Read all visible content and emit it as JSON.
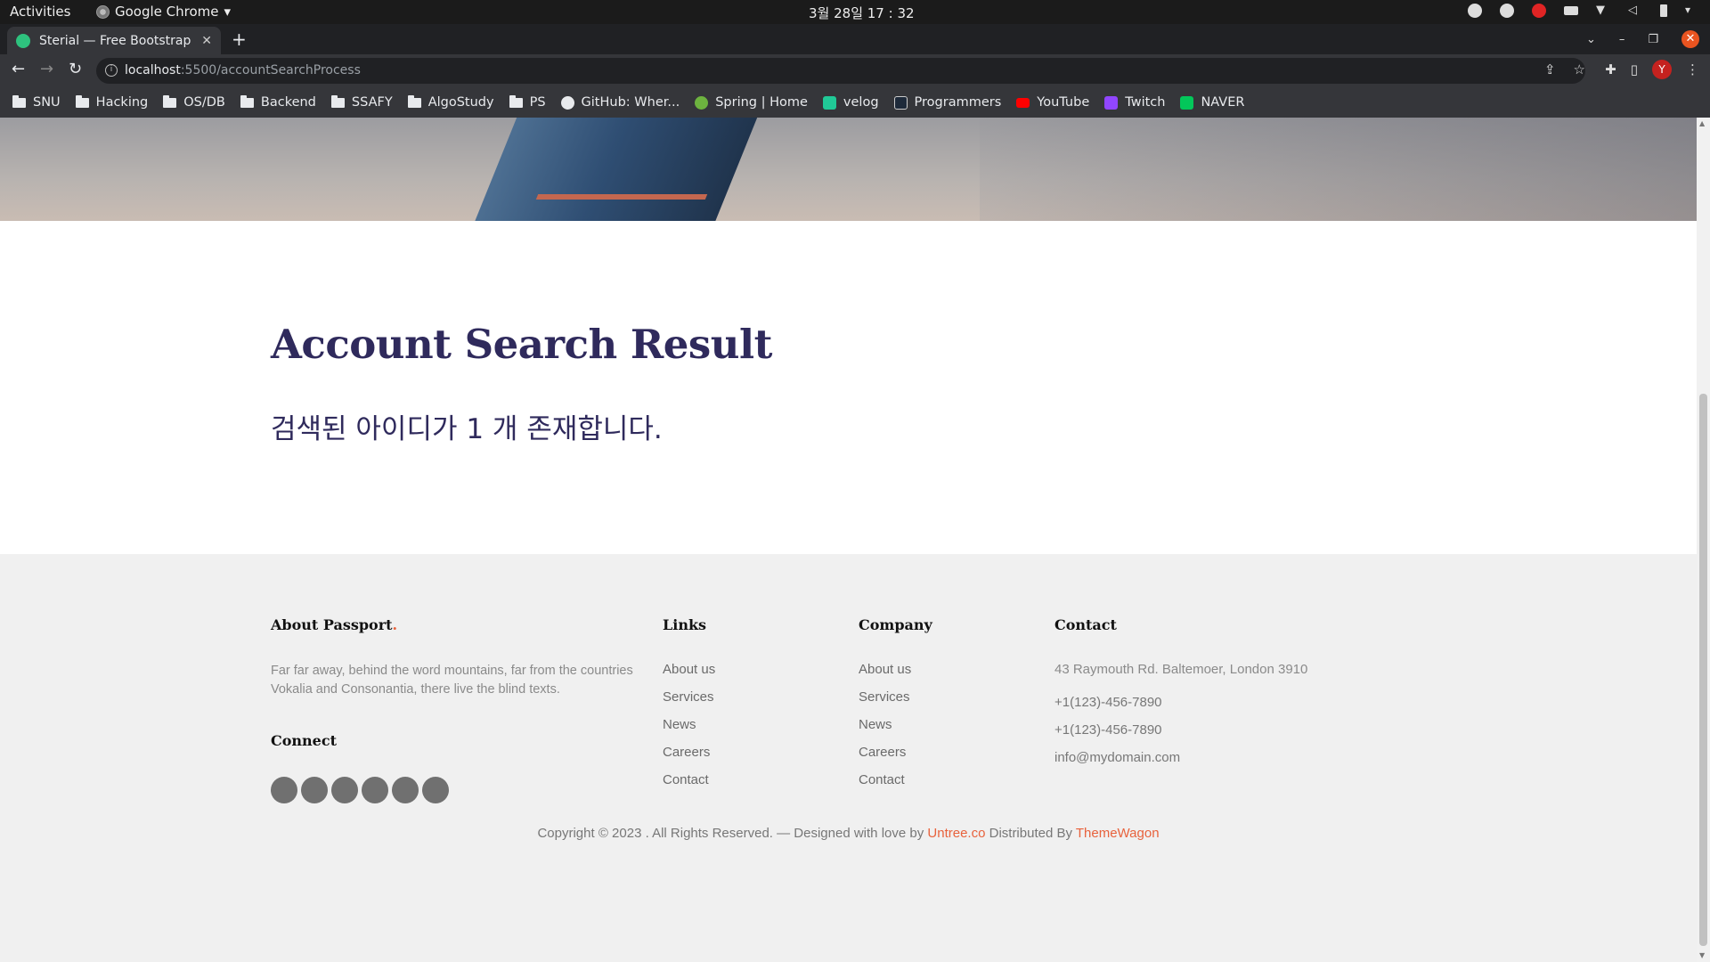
{
  "system_bar": {
    "activities": "Activities",
    "app_name": "Google Chrome",
    "clock": "3월 28일  17 : 32"
  },
  "browser": {
    "tab_title": "Sterial — Free Bootstrap",
    "url_host": "localhost",
    "url_path": ":5500/accountSearchProcess",
    "avatar_letter": "Y",
    "bookmarks": [
      {
        "label": "SNU",
        "icon": "folder-icon"
      },
      {
        "label": "Hacking",
        "icon": "folder-icon"
      },
      {
        "label": "OS/DB",
        "icon": "folder-icon"
      },
      {
        "label": "Backend",
        "icon": "folder-icon"
      },
      {
        "label": "SSAFY",
        "icon": "folder-icon"
      },
      {
        "label": "AlgoStudy",
        "icon": "folder-icon"
      },
      {
        "label": "PS",
        "icon": "folder-icon"
      },
      {
        "label": "GitHub: Wher...",
        "icon": "github-icon"
      },
      {
        "label": "Spring | Home",
        "icon": "spring-icon"
      },
      {
        "label": "velog",
        "icon": "velog-icon"
      },
      {
        "label": "Programmers",
        "icon": "programmers-icon"
      },
      {
        "label": "YouTube",
        "icon": "youtube-icon"
      },
      {
        "label": "Twitch",
        "icon": "twitch-icon"
      },
      {
        "label": "NAVER",
        "icon": "naver-icon"
      }
    ]
  },
  "page": {
    "heading": "Account Search Result",
    "message": "검색된 아이디가 1 개 존재합니다."
  },
  "footer": {
    "about": {
      "title": "About Passport",
      "dot": ".",
      "text": "Far far away, behind the word mountains, far from the countries Vokalia and Consonantia, there live the blind texts."
    },
    "connect_title": "Connect",
    "links": {
      "title": "Links",
      "items": [
        "About us",
        "Services",
        "News",
        "Careers",
        "Contact"
      ]
    },
    "company": {
      "title": "Company",
      "items": [
        "About us",
        "Services",
        "News",
        "Careers",
        "Contact"
      ]
    },
    "contact": {
      "title": "Contact",
      "address": "43 Raymouth Rd. Baltemoer, London 3910",
      "phone1": "+1(123)-456-7890",
      "phone2": "+1(123)-456-7890",
      "email": "info@mydomain.com"
    },
    "copyright": {
      "prefix": "Copyright © 2023 . All Rights Reserved. — Designed with love by ",
      "designer": "Untree.co",
      "middle": " Distributed By ",
      "distributor": "ThemeWagon"
    }
  },
  "colors": {
    "heading": "#2f2a5c",
    "accent": "#e8623c"
  }
}
